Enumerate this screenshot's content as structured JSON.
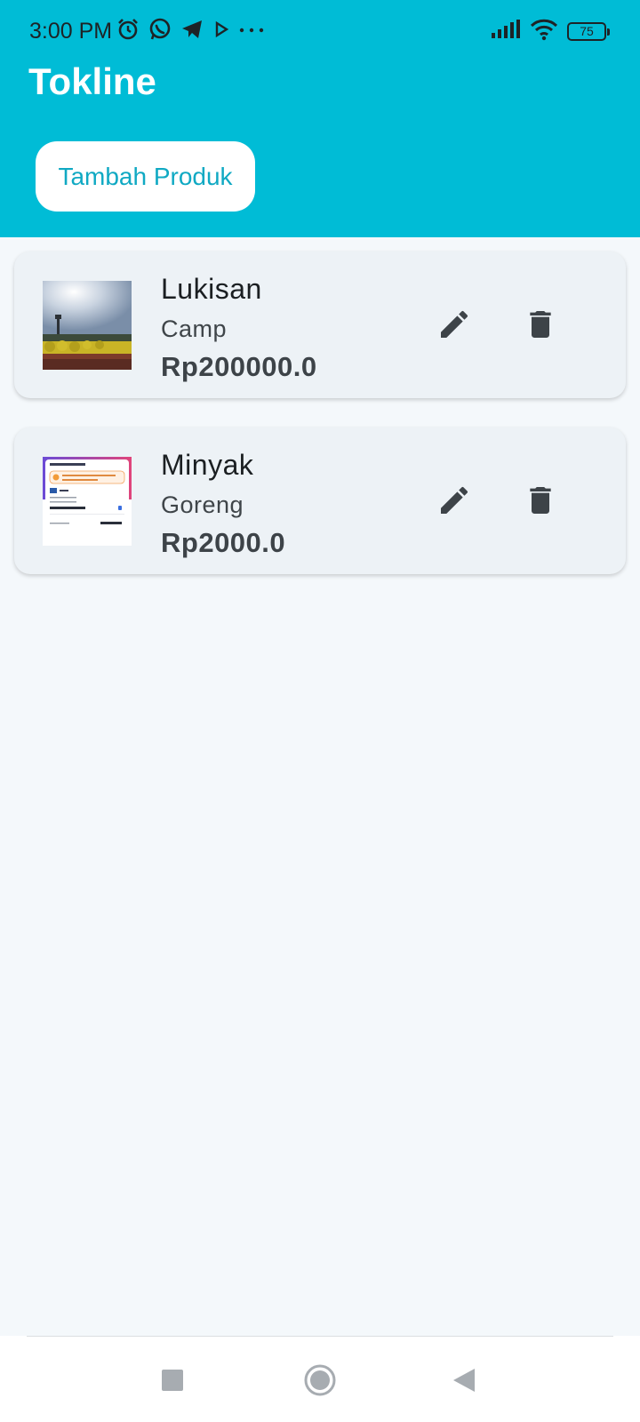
{
  "status": {
    "time": "3:00 PM",
    "left_icons": [
      "alarm-icon",
      "whatsapp-icon",
      "telegram-icon",
      "play-icon",
      "more-icon"
    ],
    "right_icons": [
      "signal-icon",
      "wifi-icon",
      "battery-icon"
    ],
    "battery": "75"
  },
  "app": {
    "title": "Tokline",
    "add_button_label": "Tambah Produk"
  },
  "products": [
    {
      "name": "Lukisan",
      "description": "Camp",
      "price": "Rp200000.0"
    },
    {
      "name": "Minyak",
      "description": "Goreng",
      "price": "Rp2000.0"
    }
  ],
  "colors": {
    "primary": "#00bcd6",
    "button_text": "#10a9c3",
    "card_bg": "#edf2f6",
    "icon": "#3d4348"
  },
  "navbar": {
    "buttons": [
      "recents-square-icon",
      "home-circle-icon",
      "back-triangle-icon"
    ]
  }
}
